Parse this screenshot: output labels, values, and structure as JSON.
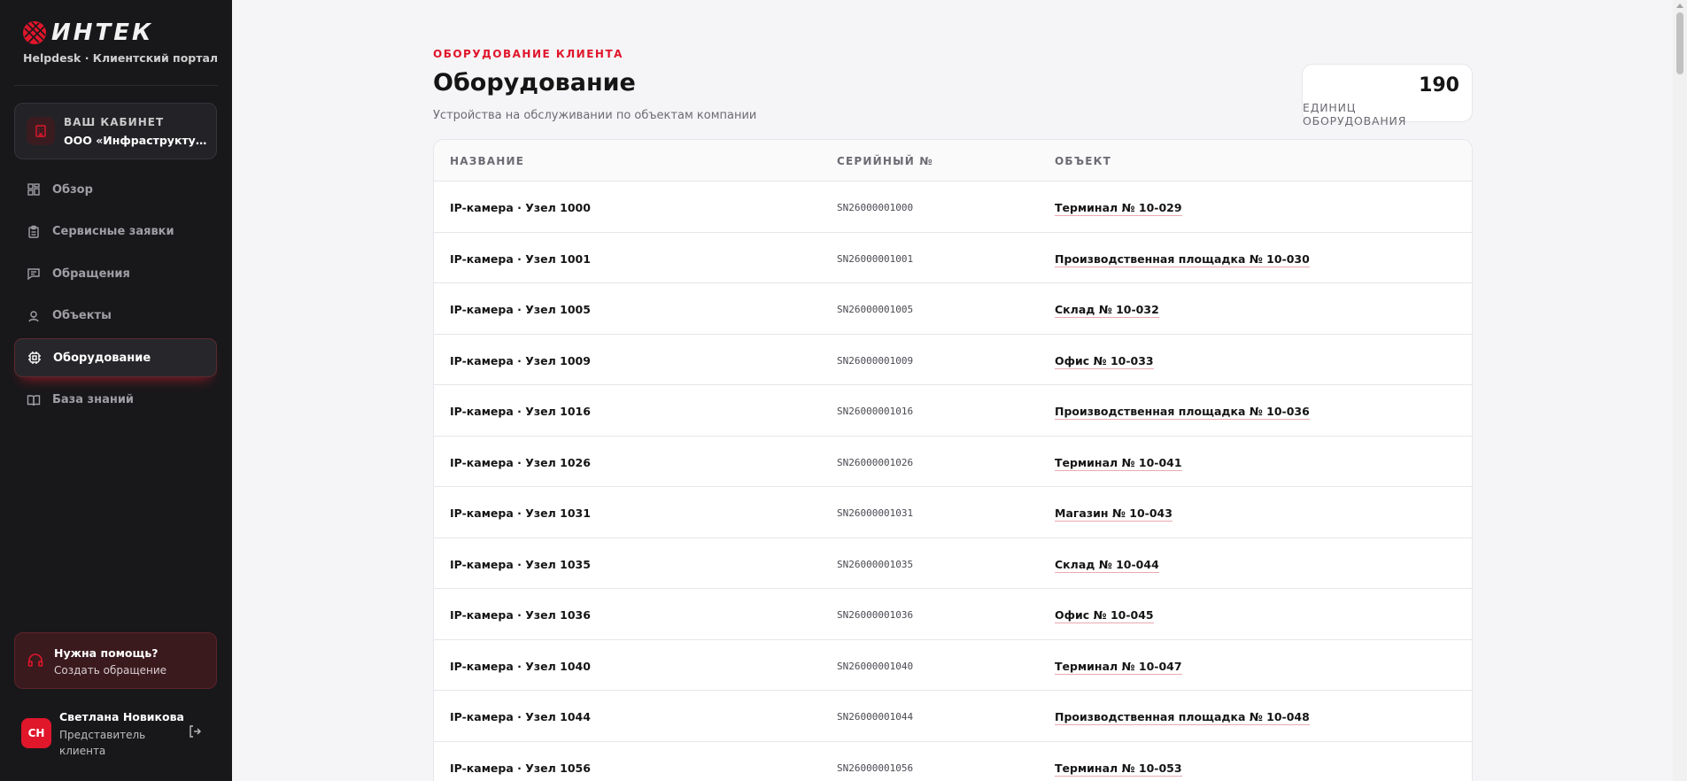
{
  "sidebar": {
    "logo_text": "ИНТЕК",
    "logo_sub": "Helpdesk · Клиентский портал",
    "cabinet": {
      "label": "ВАШ КАБИНЕТ",
      "name": "ООО «Инфраструктура п..."
    },
    "nav": [
      {
        "label": "Обзор",
        "icon": "grid-icon"
      },
      {
        "label": "Сервисные заявки",
        "icon": "clipboard-icon"
      },
      {
        "label": "Обращения",
        "icon": "message-icon"
      },
      {
        "label": "Объекты",
        "icon": "location-icon"
      },
      {
        "label": "Оборудование",
        "icon": "chip-icon",
        "active": true
      },
      {
        "label": "База знаний",
        "icon": "book-icon"
      }
    ],
    "help": {
      "title": "Нужна помощь?",
      "subtitle": "Создать обращение"
    },
    "user": {
      "initials": "СН",
      "name": "Светлана Новикова",
      "role": "Представитель клиента"
    }
  },
  "main": {
    "eyebrow": "ОБОРУДОВАНИЕ КЛИЕНТА",
    "title": "Оборудование",
    "subtitle": "Устройства на обслуживании по объектам компании",
    "stat": {
      "value": "190",
      "label": "ЕДИНИЦ ОБОРУДОВАНИЯ"
    },
    "table": {
      "headers": {
        "name": "НАЗВАНИЕ",
        "serial": "СЕРИЙНЫЙ №",
        "object": "ОБЪЕКТ"
      },
      "rows": [
        {
          "name": "IP-камера · Узел 1000",
          "serial": "SN26000001000",
          "object": "Терминал № 10-029"
        },
        {
          "name": "IP-камера · Узел 1001",
          "serial": "SN26000001001",
          "object": "Производственная площадка № 10-030"
        },
        {
          "name": "IP-камера · Узел 1005",
          "serial": "SN26000001005",
          "object": "Склад № 10-032"
        },
        {
          "name": "IP-камера · Узел 1009",
          "serial": "SN26000001009",
          "object": "Офис № 10-033"
        },
        {
          "name": "IP-камера · Узел 1016",
          "serial": "SN26000001016",
          "object": "Производственная площадка № 10-036"
        },
        {
          "name": "IP-камера · Узел 1026",
          "serial": "SN26000001026",
          "object": "Терминал № 10-041"
        },
        {
          "name": "IP-камера · Узел 1031",
          "serial": "SN26000001031",
          "object": "Магазин № 10-043"
        },
        {
          "name": "IP-камера · Узел 1035",
          "serial": "SN26000001035",
          "object": "Склад № 10-044"
        },
        {
          "name": "IP-камера · Узел 1036",
          "serial": "SN26000001036",
          "object": "Офис № 10-045"
        },
        {
          "name": "IP-камера · Узел 1040",
          "serial": "SN26000001040",
          "object": "Терминал № 10-047"
        },
        {
          "name": "IP-камера · Узел 1044",
          "serial": "SN26000001044",
          "object": "Производственная площадка № 10-048"
        },
        {
          "name": "IP-камера · Узел 1056",
          "serial": "SN26000001056",
          "object": "Терминал № 10-053"
        }
      ]
    }
  },
  "colors": {
    "accent": "#e0162b",
    "sidebar_bg": "#18181b",
    "page_bg": "#f5f5f7"
  }
}
